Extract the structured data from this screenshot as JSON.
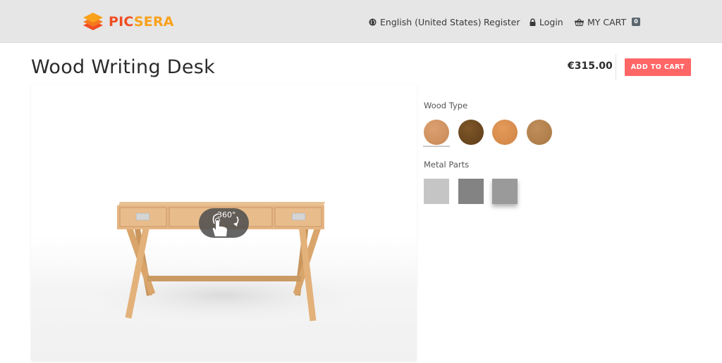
{
  "header": {
    "logo": {
      "part1": "PIC",
      "part2": "SERA",
      "colors": {
        "primary": "#f04e23",
        "secondary": "#f9a11b"
      }
    },
    "nav": {
      "language": {
        "label": "English (United States)",
        "icon": "globe-icon"
      },
      "register": {
        "label": "Register"
      },
      "login": {
        "label": "Login",
        "icon": "lock-icon"
      },
      "cart": {
        "label": "MY CART",
        "icon": "basket-icon",
        "count": "0"
      }
    }
  },
  "product": {
    "title": "Wood Writing Desk",
    "price": "€315.00",
    "add_to_cart_label": "ADD TO CART",
    "accent_color": "#ff6666"
  },
  "viewer": {
    "rotate_hint": "360°",
    "rotate_icon": "hand-rotate-icon"
  },
  "options": {
    "wood": {
      "label": "Wood Type",
      "swatches": [
        {
          "name": "light-oak",
          "color": "#d0935f",
          "selected": true
        },
        {
          "name": "walnut",
          "color": "#6e4a22",
          "selected": false
        },
        {
          "name": "cherry",
          "color": "#d98d4e",
          "selected": false
        },
        {
          "name": "teak",
          "color": "#b7834f",
          "selected": false
        }
      ]
    },
    "metal": {
      "label": "Metal Parts",
      "swatches": [
        {
          "name": "silver",
          "color": "#c5c5c5",
          "selected": false
        },
        {
          "name": "graphite",
          "color": "#838383",
          "selected": false
        },
        {
          "name": "steel",
          "color": "#9a9a9a",
          "selected": true
        }
      ]
    }
  }
}
